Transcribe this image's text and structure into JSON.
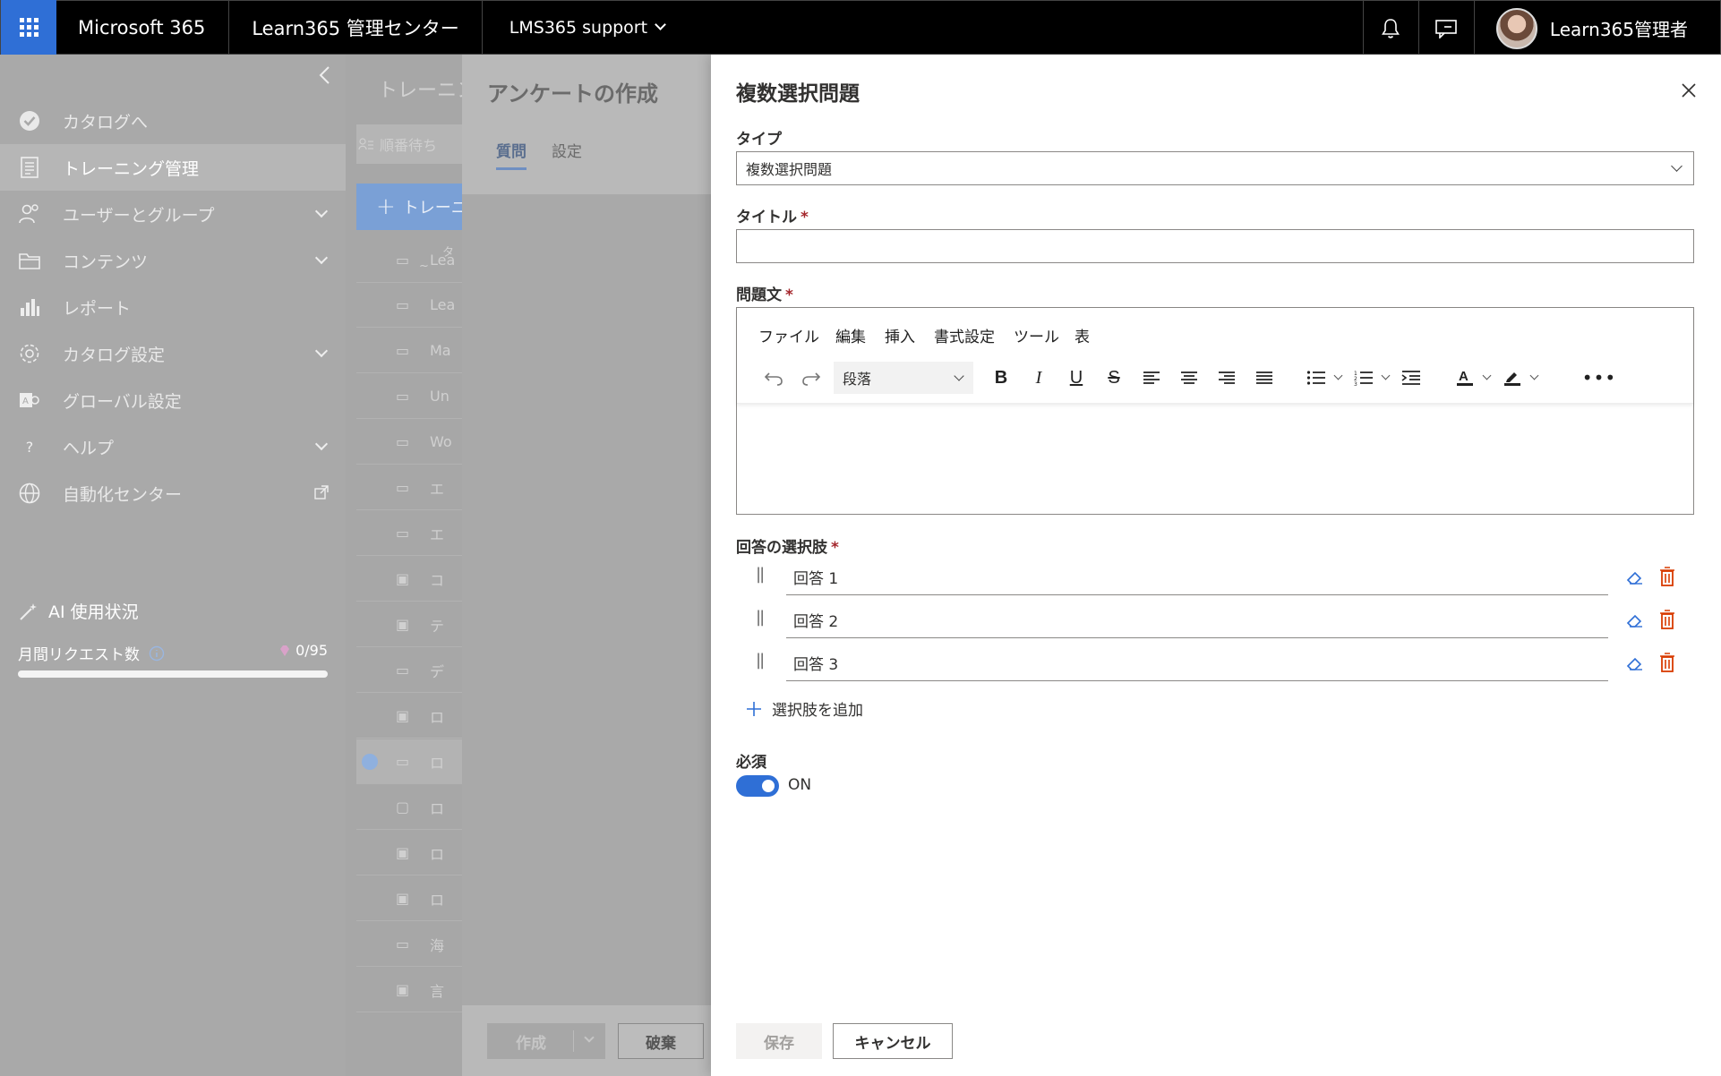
{
  "topbar": {
    "brand": "Microsoft 365",
    "admin_center": "Learn365 管理センター",
    "org": "LMS365 support",
    "user_name": "Learn365管理者"
  },
  "leftnav": {
    "items": [
      {
        "label": "カタログへ",
        "icon": "check-circle-icon"
      },
      {
        "label": "トレーニング管理",
        "icon": "document-icon"
      },
      {
        "label": "ユーザーとグループ",
        "icon": "people-icon"
      },
      {
        "label": "コンテンツ",
        "icon": "folder-icon"
      },
      {
        "label": "レポート",
        "icon": "bar-chart-icon"
      },
      {
        "label": "カタログ設定",
        "icon": "gear-icon"
      },
      {
        "label": "グローバル設定",
        "icon": "global-settings-icon"
      },
      {
        "label": "ヘルプ",
        "icon": "question-icon"
      },
      {
        "label": "自動化センター",
        "icon": "globe-icon"
      }
    ],
    "ai_title": "AI 使用状況",
    "usage_label": "月間リクエスト数",
    "usage_count": "0/95",
    "usage_fraction": 0.0
  },
  "midlist": {
    "heading": "トレーニング",
    "search_placeholder": "順番待ち",
    "new_button": "トレーニング",
    "col_header": "タ",
    "col_sub": "~",
    "rows": [
      "Lea",
      "Lea",
      "Ma",
      "Un",
      "Wo",
      "エ",
      "エ",
      "コ",
      "テ",
      "デ",
      "ロ",
      "ロ",
      "ロ",
      "ロ",
      "ロ",
      "海",
      "言"
    ]
  },
  "survey": {
    "title": "アンケートの作成",
    "tab_questions": "質問",
    "tab_settings": "設定",
    "create_button": "作成",
    "discard_button": "破棄"
  },
  "panel": {
    "title": "複数選択問題",
    "type_label": "タイプ",
    "type_value": "複数選択問題",
    "title_label": "タイトル",
    "question_label": "問題文",
    "editor_menu": [
      "ファイル",
      "編集",
      "挿入",
      "書式設定",
      "ツール",
      "表"
    ],
    "paragraph_style": "段落",
    "choices_label": "回答の選択肢",
    "choices": [
      "回答 1",
      "回答 2",
      "回答 3"
    ],
    "add_choice": "選択肢を追加",
    "required_label": "必須",
    "required_state": "ON",
    "save_button": "保存",
    "cancel_button": "キャンセル",
    "required_mark": "*"
  },
  "colors": {
    "accent": "#2f6fd6",
    "delete": "#d83b01",
    "required": "#a4262c"
  }
}
